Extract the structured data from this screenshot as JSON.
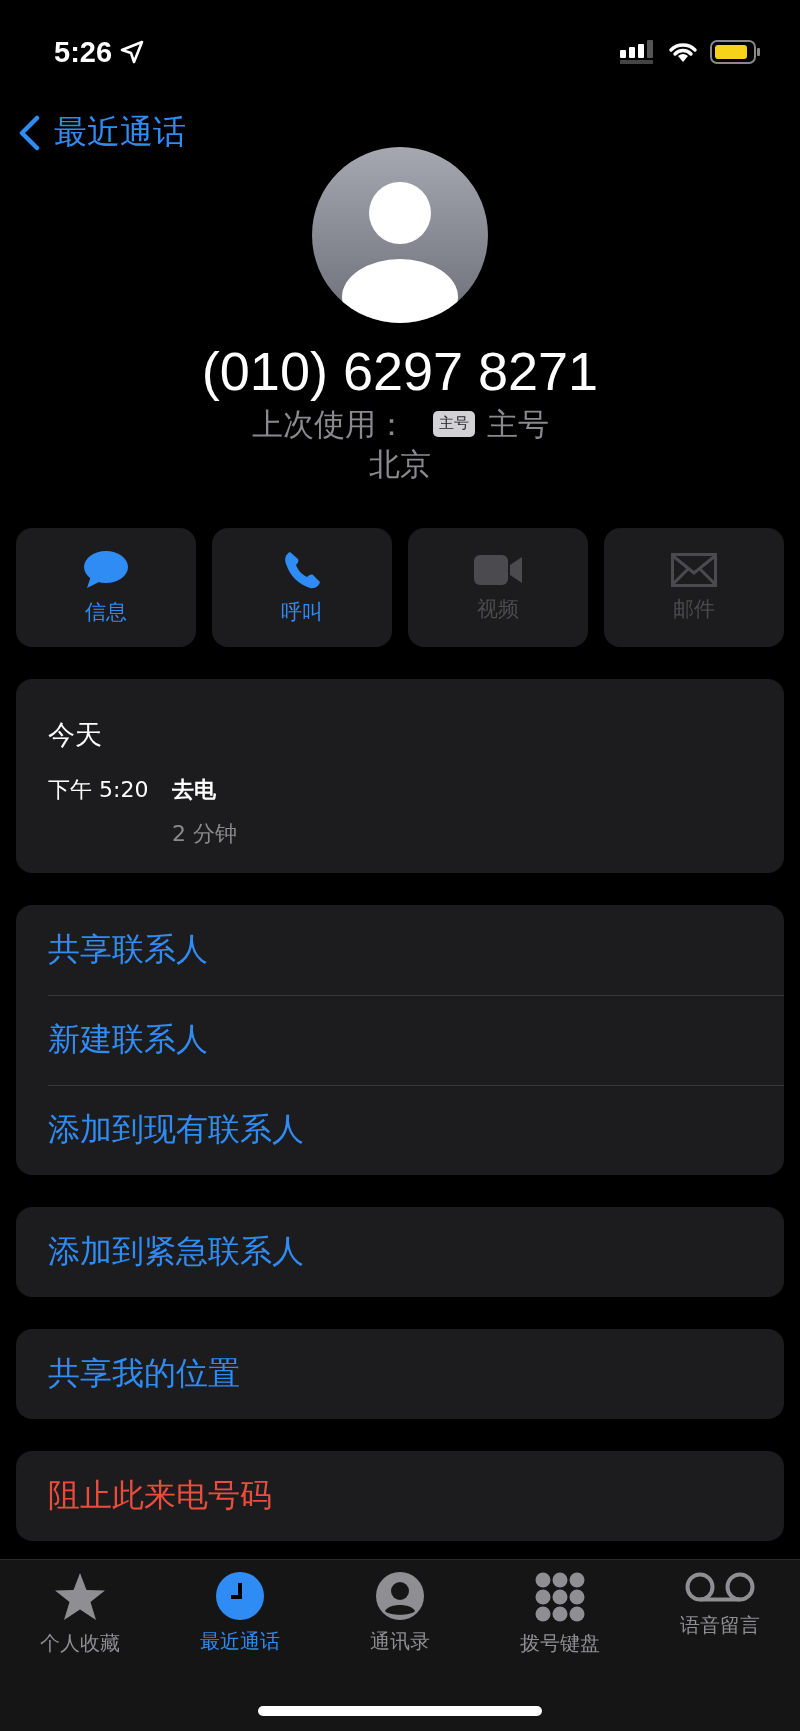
{
  "status_bar": {
    "time": "5:26"
  },
  "nav": {
    "back_label": "最近通话"
  },
  "contact": {
    "number": "(010) 6297 8271",
    "last_used_label": "上次使用：",
    "line_badge": "主号",
    "line_name": "主号",
    "location": "北京"
  },
  "actions": [
    {
      "kind": "message",
      "label": "信息",
      "disabled": false
    },
    {
      "kind": "call",
      "label": "呼叫",
      "disabled": false
    },
    {
      "kind": "video",
      "label": "视频",
      "disabled": true
    },
    {
      "kind": "mail",
      "label": "邮件",
      "disabled": true
    }
  ],
  "history": {
    "date": "今天",
    "time": "下午 5:20",
    "type": "去电",
    "duration": "2 分钟"
  },
  "option_groups": [
    {
      "items": [
        {
          "label": "共享联系人",
          "kind": "normal"
        },
        {
          "label": "新建联系人",
          "kind": "normal"
        },
        {
          "label": "添加到现有联系人",
          "kind": "normal"
        }
      ]
    },
    {
      "items": [
        {
          "label": "添加到紧急联系人",
          "kind": "normal"
        }
      ]
    },
    {
      "items": [
        {
          "label": "共享我的位置",
          "kind": "normal"
        }
      ]
    },
    {
      "items": [
        {
          "label": "阻止此来电号码",
          "kind": "destructive"
        }
      ]
    }
  ],
  "tab_bar": [
    {
      "kind": "favorites",
      "label": "个人收藏",
      "selected": false
    },
    {
      "kind": "recents",
      "label": "最近通话",
      "selected": true
    },
    {
      "kind": "contacts",
      "label": "通讯录",
      "selected": false
    },
    {
      "kind": "keypad",
      "label": "拨号键盘",
      "selected": false
    },
    {
      "kind": "voicemail",
      "label": "语音留言",
      "selected": false
    }
  ]
}
